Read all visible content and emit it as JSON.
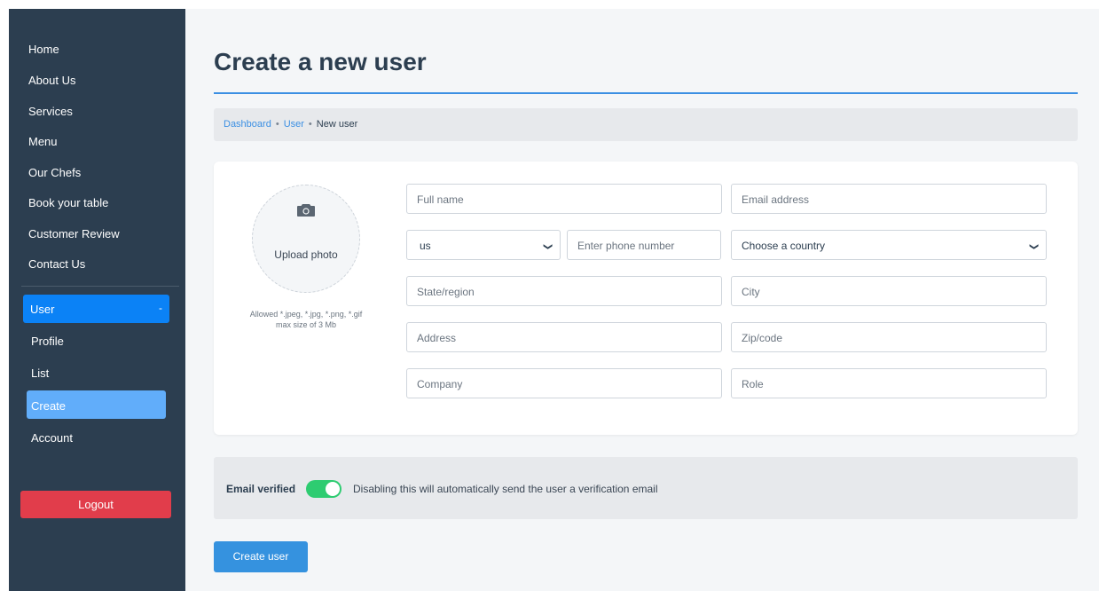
{
  "sidebar": {
    "nav": [
      {
        "label": "Home"
      },
      {
        "label": "About Us"
      },
      {
        "label": "Services"
      },
      {
        "label": "Menu"
      },
      {
        "label": "Our Chefs"
      },
      {
        "label": "Book your table"
      },
      {
        "label": "Customer Review"
      },
      {
        "label": "Contact Us"
      }
    ],
    "user_group": {
      "label": "User",
      "indicator": "-"
    },
    "sub_items": [
      {
        "label": "Profile"
      },
      {
        "label": "List"
      },
      {
        "label": "Create",
        "active": true
      },
      {
        "label": "Account"
      }
    ],
    "logout_label": "Logout"
  },
  "main": {
    "title": "Create a new user",
    "breadcrumb": {
      "items": [
        "Dashboard",
        "User",
        "New user"
      ],
      "separator": "•"
    },
    "upload": {
      "label": "Upload photo",
      "hint_line1": "Allowed *.jpeg, *.jpg, *.png, *.gif",
      "hint_line2": "max size of 3 Mb"
    },
    "form": {
      "full_name": {
        "placeholder": "Full name"
      },
      "email": {
        "placeholder": "Email address"
      },
      "phone_code": {
        "value": "us"
      },
      "phone": {
        "placeholder": "Enter phone number"
      },
      "country": {
        "value": "Choose a country"
      },
      "state": {
        "placeholder": "State/region"
      },
      "city": {
        "placeholder": "City"
      },
      "address": {
        "placeholder": "Address"
      },
      "zip": {
        "placeholder": "Zip/code"
      },
      "company": {
        "placeholder": "Company"
      },
      "role": {
        "placeholder": "Role"
      }
    },
    "verify": {
      "label": "Email verified",
      "enabled": true,
      "description": "Disabling this will automatically send the user a verification email"
    },
    "create_button": "Create user"
  },
  "colors": {
    "sidebar_bg": "#2c3e50",
    "accent": "#3b8fe3",
    "danger": "#e13d4b",
    "toggle_on": "#2ecc71"
  },
  "icons": {
    "upload": "camera-icon",
    "select": "chevron-down-icon"
  }
}
